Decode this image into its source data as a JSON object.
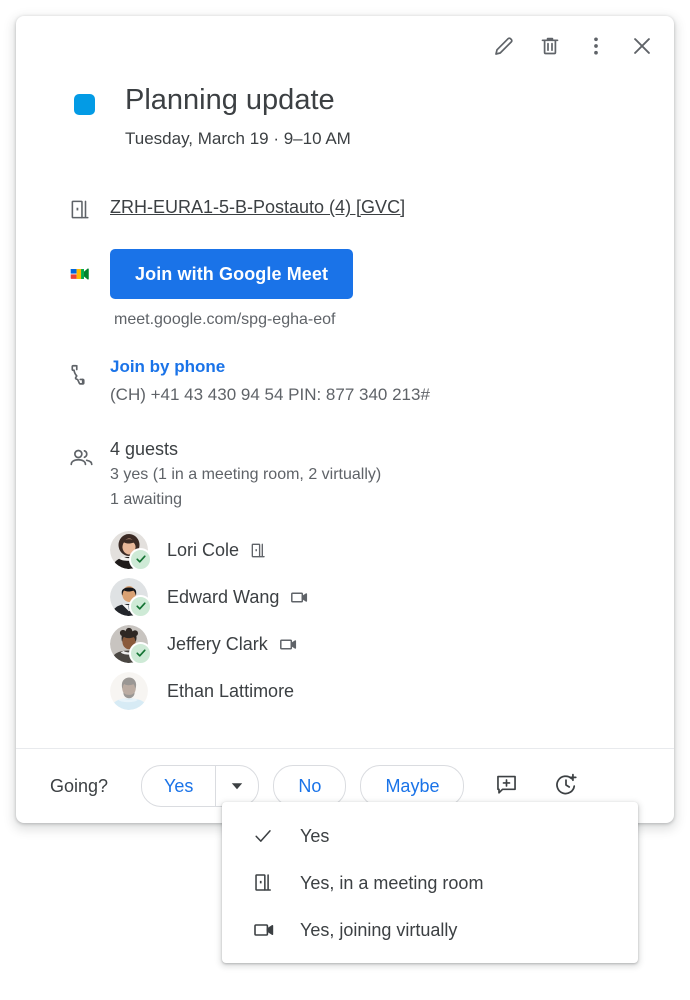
{
  "card": {
    "header_actions": [
      {
        "name": "edit-event-button",
        "icon": "pencil-icon",
        "tooltip": "Edit event"
      },
      {
        "name": "delete-event-button",
        "icon": "trash-icon",
        "tooltip": "Delete event"
      },
      {
        "name": "more-options-button",
        "icon": "more-vert-icon",
        "tooltip": "Options"
      },
      {
        "name": "close-button",
        "icon": "close-icon",
        "tooltip": "Close"
      }
    ],
    "event": {
      "color": "#039BE5",
      "title": "Planning update",
      "when": "Tuesday, March 19  ·  9–10 AM"
    },
    "room": {
      "icon": "meeting-room-icon",
      "name": "ZRH-EURA1-5-B-Postauto (4) [GVC]"
    },
    "meet": {
      "icon": "google-meet-icon",
      "button_label": "Join with Google Meet",
      "button_color": "#1a73e8",
      "url": "meet.google.com/spg-egha-eof"
    },
    "phone": {
      "icon": "phone-icon",
      "link_label": "Join by phone",
      "link_color": "#1a73e8",
      "number": "(CH) +41 43 430 94 54 PIN: 877 340 213#"
    },
    "guests": {
      "icon": "people-icon",
      "count_label": "4 guests",
      "summary_yes": "3 yes (1 in a meeting room, 2 virtually)",
      "summary_awaiting": "1 awaiting",
      "list": [
        {
          "name": "Lori Cole",
          "accepted": true,
          "mode": "meeting-room-icon",
          "avatar": "lori"
        },
        {
          "name": "Edward Wang",
          "accepted": true,
          "mode": "video-camera-icon",
          "avatar": "edward"
        },
        {
          "name": "Jeffery Clark",
          "accepted": true,
          "mode": "video-camera-icon",
          "avatar": "jeffery"
        },
        {
          "name": "Ethan Lattimore",
          "accepted": false,
          "mode": "none",
          "avatar": "ethan"
        }
      ]
    },
    "footer": {
      "going_label": "Going?",
      "yes_label": "Yes",
      "yes_dropdown_icon": "chevron-down-icon",
      "no_label": "No",
      "maybe_label": "Maybe",
      "icons": [
        {
          "name": "add-comment-button",
          "icon": "add-comment-icon"
        },
        {
          "name": "remind-later-button",
          "icon": "clock-plus-icon"
        }
      ]
    }
  },
  "dropdown": {
    "items": [
      {
        "label": "Yes",
        "icon": "checkmark-icon",
        "selected": true
      },
      {
        "label": "Yes, in a meeting room",
        "icon": "meeting-room-icon",
        "selected": false
      },
      {
        "label": "Yes, joining virtually",
        "icon": "video-camera-icon",
        "selected": false
      }
    ]
  }
}
